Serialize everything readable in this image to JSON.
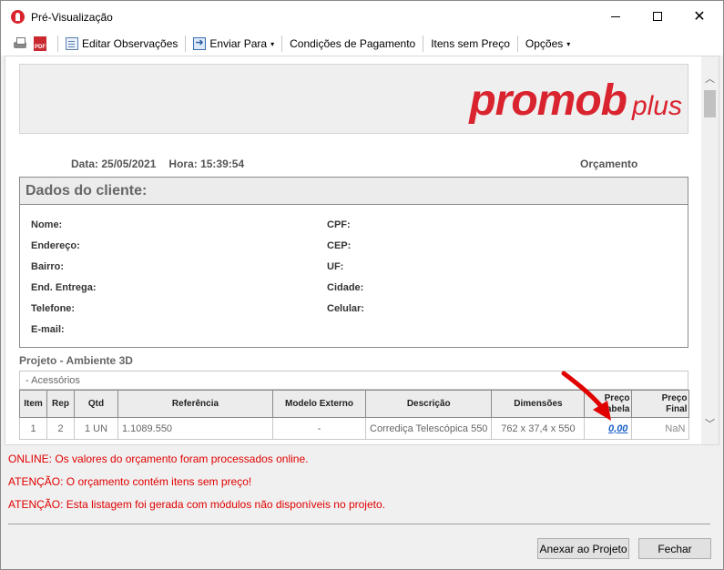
{
  "window": {
    "title": "Pré-Visualização",
    "close_glyph": "✕"
  },
  "toolbar": {
    "pdf_label": "PDF",
    "edit_notes": "Editar Observações",
    "send_to": "Enviar Para",
    "payment_terms": "Condições de Pagamento",
    "unpriced_items": "Itens sem Preço",
    "options": "Opções",
    "caret": "▾"
  },
  "report": {
    "logo_main": "promob",
    "logo_sub": "plus",
    "date_label": "Data: 25/05/2021",
    "hour_label": "Hora: 15:39:54",
    "doc_type": "Orçamento",
    "client_section_title": "Dados do cliente:",
    "client_fields_left": [
      "Nome:",
      "Endereço:",
      "Bairro:",
      "End. Entrega:",
      "Telefone:",
      "E-mail:"
    ],
    "client_fields_right": [
      "CPF:",
      "CEP:",
      "UF:",
      "Cidade:",
      "Celular:"
    ],
    "project_title": "Projeto - Ambiente 3D",
    "group_label": "- Acessórios",
    "table": {
      "headers": [
        "Item",
        "Rep",
        "Qtd",
        "Referência",
        "Modelo Externo",
        "Descrição",
        "Dimensões",
        "Preço Tabela",
        "Preço Final"
      ],
      "header_price_table": [
        "Preço",
        "Tabela"
      ],
      "header_price_final": [
        "Preço",
        "Final"
      ],
      "rows": [
        [
          "1",
          "2",
          "1 UN",
          "1.1089.550",
          "-",
          "Corrediça Telescópica 550",
          "762 x 37,4 x 550",
          "0,00",
          "NaN"
        ]
      ]
    }
  },
  "messages": [
    "ONLINE: Os valores do orçamento foram processados online.",
    "ATENÇÃO: O orçamento contém itens sem preço!",
    "ATENÇÃO: Esta listagem foi gerada com módulos não disponíveis no projeto."
  ],
  "buttons": {
    "attach": "Anexar ao Projeto",
    "close": "Fechar"
  },
  "colors": {
    "brand_red": "#d9232e",
    "message_red": "#e10000",
    "link_blue": "#1a5fc8"
  }
}
